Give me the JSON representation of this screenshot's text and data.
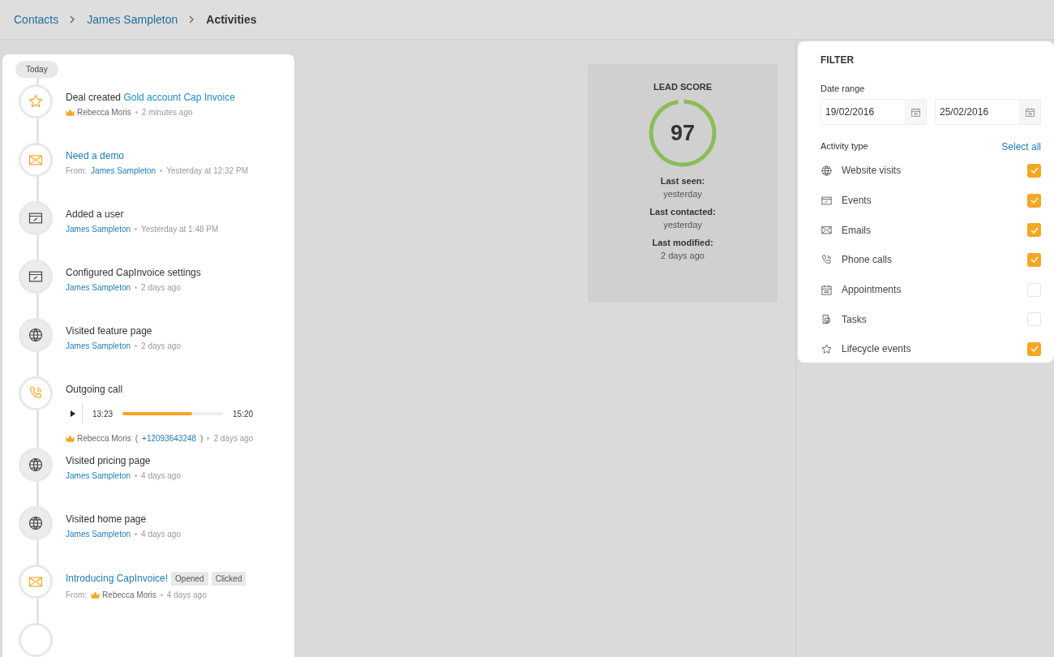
{
  "breadcrumbs": [
    {
      "label": "Contacts",
      "current": false
    },
    {
      "label": "James Sampleton",
      "current": false
    },
    {
      "label": "Activities",
      "current": true
    }
  ],
  "timeline": {
    "date_chip": "Today",
    "items": [
      {
        "kind": "deal",
        "title": "Deal created",
        "link": "Gold account Cap Invoice",
        "meta": [
          {
            "kind": "owner",
            "text": "Rebecca Moris"
          },
          {
            "kind": "time",
            "text": "2 minutes ago"
          }
        ]
      },
      {
        "kind": "email",
        "link": "Need a demo",
        "meta": [
          {
            "kind": "prefix",
            "text": "From:"
          },
          {
            "kind": "link",
            "text": "James Sampleton"
          },
          {
            "kind": "time",
            "text": "Yesterday at 12:32 PM"
          }
        ]
      },
      {
        "kind": "event",
        "title": "Added a user",
        "meta": [
          {
            "kind": "link",
            "text": "James Sampleton"
          },
          {
            "kind": "time",
            "text": "Yesterday at 1:48 PM"
          }
        ]
      },
      {
        "kind": "event",
        "title": "Configured CapInvoice settings",
        "meta": [
          {
            "kind": "link",
            "text": "James Sampleton"
          },
          {
            "kind": "time",
            "text": "2 days ago"
          }
        ]
      },
      {
        "kind": "visit",
        "title": "Visited feature page",
        "meta": [
          {
            "kind": "link",
            "text": "James Sampleton"
          },
          {
            "kind": "time",
            "text": "2 days ago"
          }
        ]
      },
      {
        "kind": "call",
        "title": "Outgoing call",
        "player": {
          "start": "13:23",
          "end": "15:20",
          "level": 0.69
        },
        "meta": [
          {
            "kind": "owner",
            "text": "Rebecca Moris"
          },
          {
            "kind": "plain",
            "text": "("
          },
          {
            "kind": "link",
            "text": "+12093643248"
          },
          {
            "kind": "plain",
            "text": ")"
          },
          {
            "kind": "time",
            "text": "2 days ago"
          }
        ]
      },
      {
        "kind": "visit",
        "title": "Visited pricing page",
        "meta": [
          {
            "kind": "link",
            "text": "James Sampleton"
          },
          {
            "kind": "time",
            "text": "4 days ago"
          }
        ]
      },
      {
        "kind": "visit",
        "title": "Visited home  page",
        "meta": [
          {
            "kind": "link",
            "text": "James Sampleton"
          },
          {
            "kind": "time",
            "text": "4 days ago"
          }
        ]
      },
      {
        "kind": "email",
        "link": "Introducing CapInvoice!",
        "tags": [
          "Opened",
          "Clicked"
        ],
        "meta": [
          {
            "kind": "prefix",
            "text": "From:"
          },
          {
            "kind": "owner",
            "text": "Rebecca Moris"
          },
          {
            "kind": "time",
            "text": "4 days ago"
          }
        ]
      }
    ]
  },
  "lead_score": {
    "title": "LEAD SCORE",
    "score": "97",
    "level": 0.97,
    "facts": [
      {
        "label": "Last seen:",
        "value": "yesterday"
      },
      {
        "label": "Last contacted:",
        "value": "yesterday"
      },
      {
        "label": "Last modified:",
        "value": "2 days ago"
      }
    ]
  },
  "filter": {
    "title": "FILTER",
    "date_label": "Date range",
    "from": "19/02/2016",
    "to": "25/02/2016",
    "type_label": "Activity type",
    "select_all": "Select all",
    "types": [
      {
        "kind": "visit",
        "label": "Website visits",
        "checked": true
      },
      {
        "kind": "event",
        "label": "Events",
        "checked": true
      },
      {
        "kind": "email",
        "label": "Emails",
        "checked": true
      },
      {
        "kind": "call",
        "label": "Phone calls",
        "checked": true
      },
      {
        "kind": "appointment",
        "label": "Appointments",
        "checked": false
      },
      {
        "kind": "task",
        "label": "Tasks",
        "checked": false
      },
      {
        "kind": "deal",
        "label": "Lifecycle events",
        "checked": true
      }
    ]
  }
}
